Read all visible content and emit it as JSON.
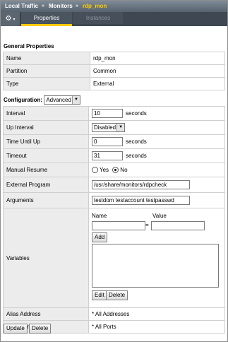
{
  "breadcrumb": {
    "part1": "Local Traffic",
    "sep1": "»",
    "part2": "Monitors",
    "sep2": "»",
    "current": "rdp_mon"
  },
  "tabs": {
    "gear_icon": "gear-icon",
    "properties": "Properties",
    "instances": "Instances"
  },
  "general": {
    "title": "General Properties",
    "rows": [
      {
        "label": "Name",
        "value": "rdp_mon"
      },
      {
        "label": "Partition",
        "value": "Common"
      },
      {
        "label": "Type",
        "value": "External"
      }
    ]
  },
  "config": {
    "label": "Configuration:",
    "mode": "Advanced",
    "interval": {
      "label": "Interval",
      "value": "10",
      "unit": "seconds"
    },
    "up_interval": {
      "label": "Up Interval",
      "value": "Disabled"
    },
    "time_until_up": {
      "label": "Time Until Up",
      "value": "0",
      "unit": "seconds"
    },
    "timeout": {
      "label": "Timeout",
      "value": "31",
      "unit": "seconds"
    },
    "manual_resume": {
      "label": "Manual Resume",
      "yes": "Yes",
      "no": "No",
      "selected": "No"
    },
    "external_program": {
      "label": "External Program",
      "value": "/usr/share/monitors/rdpcheck"
    },
    "arguments": {
      "label": "Arguments",
      "value": "testdom testaccount testpasswd"
    },
    "variables": {
      "label": "Variables",
      "name_header": "Name",
      "value_header": "Value",
      "equals": "=",
      "name_value": "",
      "value_value": "",
      "add": "Add",
      "edit": "Edit",
      "delete": "Delete"
    },
    "alias_address": {
      "label": "Alias Address",
      "value": "* All Addresses"
    },
    "alias_service_port": {
      "label": "Alias Service Port",
      "value": "* All Ports"
    }
  },
  "actions": {
    "update": "Update",
    "delete": "Delete"
  }
}
